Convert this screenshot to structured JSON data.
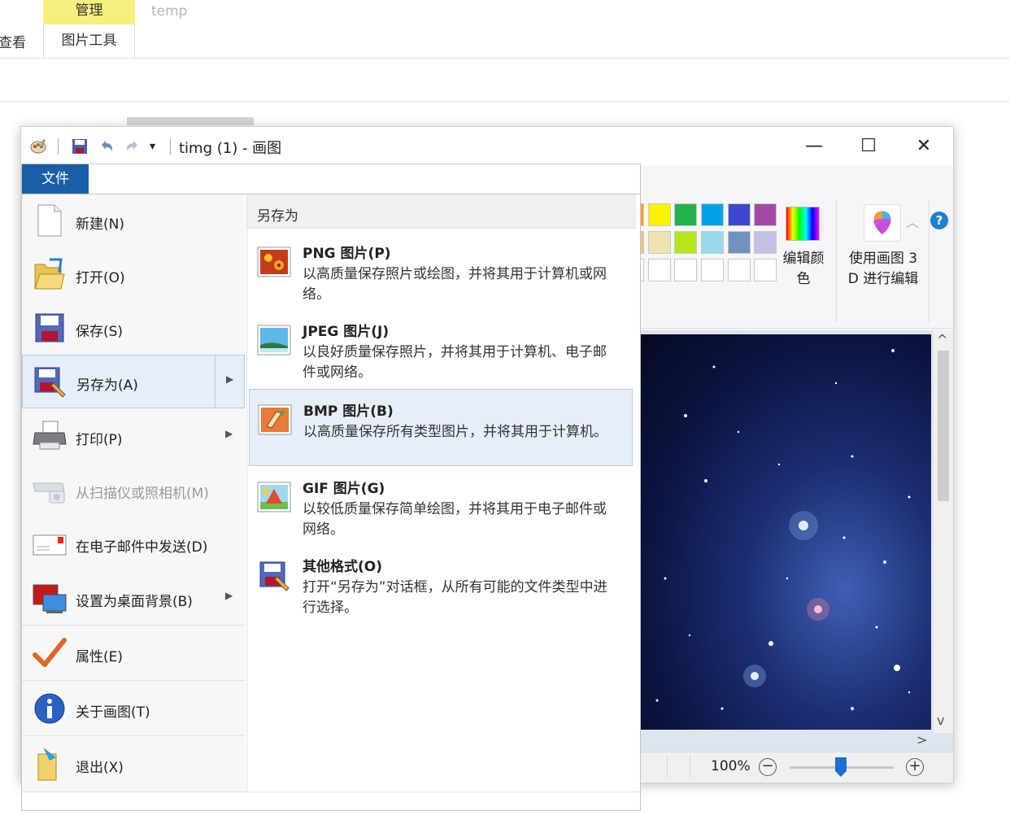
{
  "explorer": {
    "contextual_group": "管理",
    "tab_temp": "temp",
    "tab_view": "查看",
    "tab_picture_tools": "图片工具"
  },
  "paint": {
    "title": "timg (1) - 画图",
    "window_buttons": {
      "minimize": "—",
      "maximize": "☐",
      "close": "✕"
    },
    "help": "?",
    "edit_colors": "编辑颜色",
    "paint3d": "使用画图 3 D 进行编辑",
    "zoom": "100%",
    "zoom_minus": "−",
    "zoom_plus": "+",
    "palette_row1": [
      "#f9a31b",
      "#fff200",
      "#22b14c",
      "#00a2e8",
      "#3f48cc",
      "#a349a4"
    ],
    "palette_row2": [
      "#efe4b0",
      "#b5e61d",
      "#99d9ea",
      "#7092be",
      "#c8bfe7"
    ],
    "scroll": {
      "up": "^",
      "down": "v",
      "right": ">"
    }
  },
  "file_menu": {
    "tab": "文件",
    "items": [
      {
        "label": "新建(N)",
        "icon": "new-file-icon"
      },
      {
        "label": "打开(O)",
        "icon": "open-folder-icon"
      },
      {
        "label": "保存(S)",
        "icon": "save-disk-icon"
      },
      {
        "label": "另存为(A)",
        "icon": "save-as-icon",
        "selected": true,
        "submenu": true
      },
      {
        "label": "打印(P)",
        "icon": "printer-icon",
        "submenu": true
      },
      {
        "label": "从扫描仪或照相机(M)",
        "icon": "scanner-icon",
        "disabled": true
      },
      {
        "label": "在电子邮件中发送(D)",
        "icon": "email-icon"
      },
      {
        "label": "设置为桌面背景(B)",
        "icon": "desktop-background-icon",
        "submenu": true
      },
      {
        "label": "属性(E)",
        "icon": "checkmark-icon"
      },
      {
        "label": "关于画图(T)",
        "icon": "info-icon"
      },
      {
        "label": "退出(X)",
        "icon": "exit-icon"
      }
    ],
    "save_as": {
      "header": "另存为",
      "options": [
        {
          "title": "PNG 图片(P)",
          "desc": "以高质量保存照片或绘图，并将其用于计算机或网络。",
          "icon": "png-image-icon"
        },
        {
          "title": "JPEG 图片(J)",
          "desc": "以良好质量保存照片，并将其用于计算机、电子邮件或网络。",
          "icon": "jpeg-image-icon"
        },
        {
          "title": "BMP 图片(B)",
          "desc": "以高质量保存所有类型图片，并将其用于计算机。",
          "icon": "bmp-image-icon",
          "hover": true
        },
        {
          "title": "GIF 图片(G)",
          "desc": "以较低质量保存简单绘图，并将其用于电子邮件或网络。",
          "icon": "gif-image-icon"
        },
        {
          "title": "其他格式(O)",
          "desc": "打开“另存为”对话框，从所有可能的文件类型中进行选择。",
          "icon": "other-formats-icon"
        }
      ]
    }
  }
}
